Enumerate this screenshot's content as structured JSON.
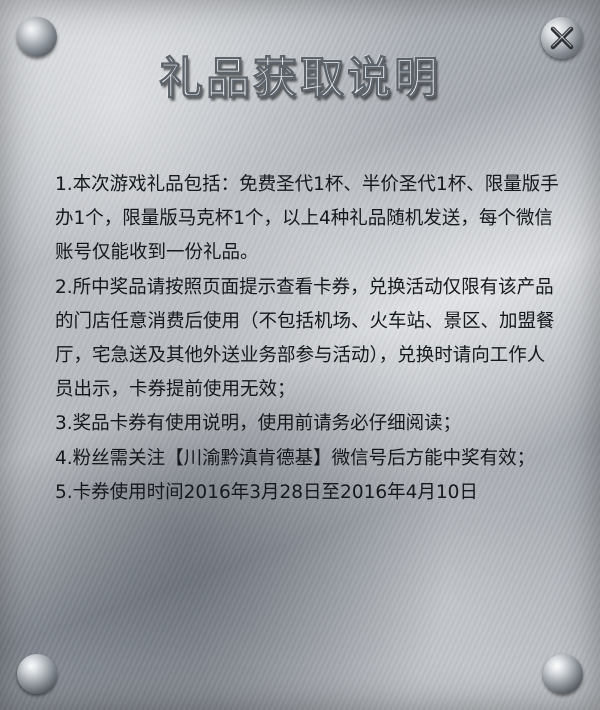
{
  "dialog": {
    "title": "礼品获取说明",
    "close_icon": "close-x-icon",
    "items": [
      "1.本次游戏礼品包括：免费圣代1杯、半价圣代1杯、限量版手办1个，限量版马克杯1个，以上4种礼品随机发送，每个微信账号仅能收到一份礼品。",
      "2.所中奖品请按照页面提示查看卡券，兑换活动仅限有该产品的门店任意消费后使用（不包括机场、火车站、景区、加盟餐厅，宅急送及其他外送业务部参与活动），兑换时请向工作人员出示，卡券提前使用无效；",
      "3.奖品卡券有使用说明，使用前请务必仔细阅读；",
      "4.粉丝需关注【川渝黔滇肯德基】微信号后方能中奖有效；",
      "5.卡券使用时间2016年3月28日至2016年4月10日"
    ]
  },
  "colors": {
    "text": "#15181c",
    "title": "#f4f5f7",
    "metal": "#b8bcc2"
  }
}
